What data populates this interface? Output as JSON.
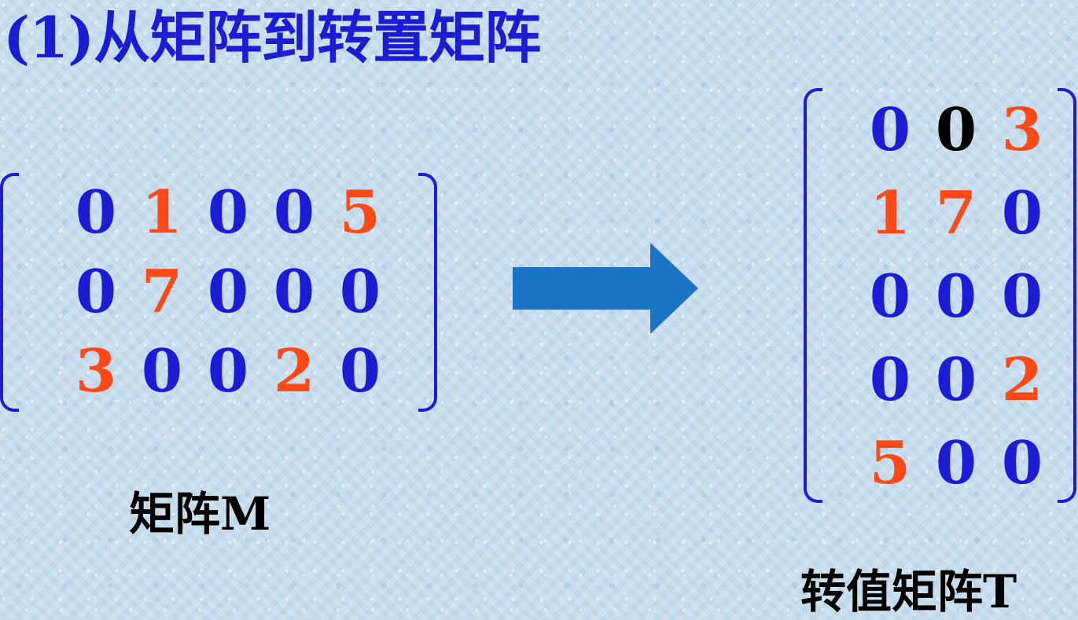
{
  "title": "(1)从矩阵到转置矩阵",
  "matrix_m": {
    "caption": "矩阵M",
    "cells": [
      [
        {
          "text": "0",
          "tone": "blue"
        },
        {
          "text": "1",
          "tone": "red"
        },
        {
          "text": "0",
          "tone": "blue"
        },
        {
          "text": "0",
          "tone": "blue"
        },
        {
          "text": "5",
          "tone": "red"
        }
      ],
      [
        {
          "text": "0",
          "tone": "blue"
        },
        {
          "text": "7",
          "tone": "red"
        },
        {
          "text": "0",
          "tone": "blue"
        },
        {
          "text": "0",
          "tone": "blue"
        },
        {
          "text": "0",
          "tone": "blue"
        }
      ],
      [
        {
          "text": "3",
          "tone": "red"
        },
        {
          "text": "0",
          "tone": "blue"
        },
        {
          "text": "0",
          "tone": "blue"
        },
        {
          "text": "2",
          "tone": "red"
        },
        {
          "text": "0",
          "tone": "blue"
        }
      ]
    ]
  },
  "matrix_t": {
    "caption": "转值矩阵T",
    "cells": [
      [
        {
          "text": "0",
          "tone": "blue"
        },
        {
          "text": "0",
          "tone": "black"
        },
        {
          "text": "3",
          "tone": "red"
        }
      ],
      [
        {
          "text": "1",
          "tone": "red"
        },
        {
          "text": "7",
          "tone": "red"
        },
        {
          "text": "0",
          "tone": "blue"
        }
      ],
      [
        {
          "text": "0",
          "tone": "blue"
        },
        {
          "text": "0",
          "tone": "blue"
        },
        {
          "text": "0",
          "tone": "blue"
        }
      ],
      [
        {
          "text": "0",
          "tone": "blue"
        },
        {
          "text": "0",
          "tone": "blue"
        },
        {
          "text": "2",
          "tone": "red"
        }
      ],
      [
        {
          "text": "5",
          "tone": "red"
        },
        {
          "text": "0",
          "tone": "blue"
        },
        {
          "text": "0",
          "tone": "blue"
        }
      ]
    ]
  },
  "colors": {
    "title": "#1d1bd4",
    "matrix_default": "#1d1bd4",
    "matrix_highlight": "#ff4a18",
    "caption": "#000000",
    "arrow": "#1c74c7",
    "background": "#c7dcec"
  }
}
